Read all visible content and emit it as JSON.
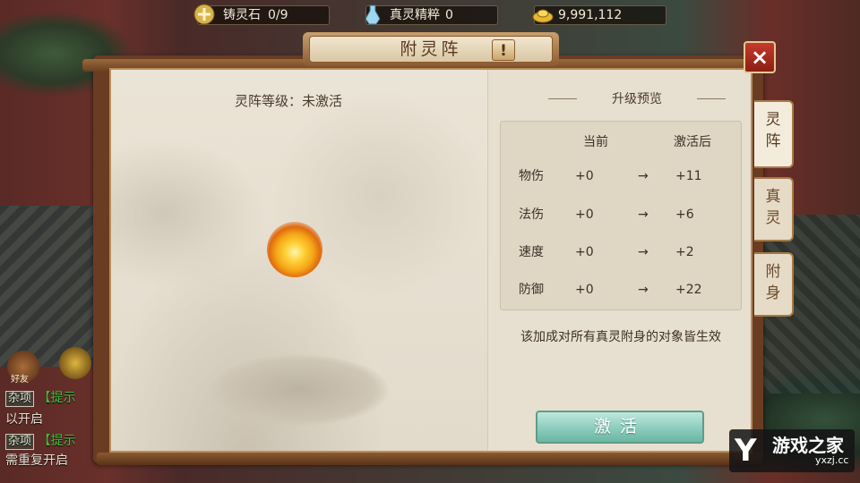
{
  "resources": [
    {
      "label": "铸灵石",
      "value": "0/9",
      "icon": "spirit-stone-icon"
    },
    {
      "label": "真灵精粹",
      "value": "0",
      "icon": "essence-bottle-icon"
    },
    {
      "label": "",
      "value": "9,991,112",
      "icon": "gold-ingot-icon"
    }
  ],
  "window": {
    "title": "附灵阵",
    "info_label": "!",
    "close_label": "×"
  },
  "tabs": [
    {
      "label_1": "灵",
      "label_2": "阵",
      "active": true
    },
    {
      "label_1": "真",
      "label_2": "灵",
      "active": false
    },
    {
      "label_1": "附",
      "label_2": "身",
      "active": false
    }
  ],
  "formation": {
    "level_text": "灵阵等级：未激活"
  },
  "preview": {
    "title": "升级预览",
    "col_current": "当前",
    "col_after": "激活后",
    "arrow": "→",
    "rows": [
      {
        "name": "物伤",
        "current": "+0",
        "after": "+11"
      },
      {
        "name": "法伤",
        "current": "+0",
        "after": "+6"
      },
      {
        "name": "速度",
        "current": "+0",
        "after": "+2"
      },
      {
        "name": "防御",
        "current": "+0",
        "after": "+22"
      }
    ],
    "note": "该加成对所有真灵附身的对象皆生效"
  },
  "activate_label": "激活",
  "chat": {
    "friend_label": "好友",
    "line1_tag": "杂项",
    "line1_bracket": "【提示",
    "line2": "以开启",
    "line3_tag": "杂项",
    "line3_bracket": "【提示",
    "line4": "需重复开启"
  },
  "logo": {
    "mark": "Y",
    "name": "游戏之家",
    "site": "yxzj.cc"
  },
  "colors": {
    "accent_activate": "#8fcfbf",
    "close_red": "#c43a2c",
    "panel_frame": "#6a3c22"
  }
}
